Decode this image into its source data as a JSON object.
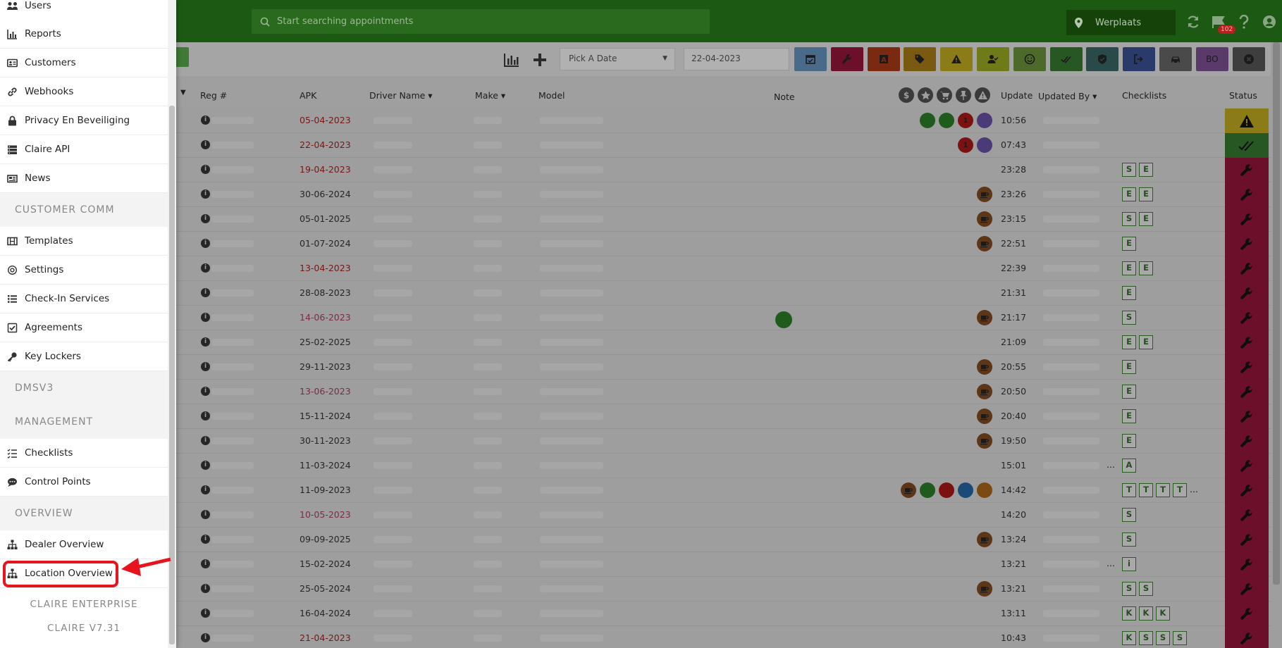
{
  "topbar": {
    "search_placeholder": "Start searching appointments",
    "location": "Werplaats",
    "notification_count": "102"
  },
  "toolbar": {
    "date_picker_label": "Pick A Date",
    "date_value": "22-04-2023",
    "filter_buttons": [
      {
        "icon": "calendar-check-icon",
        "color": "#4a6a8a"
      },
      {
        "icon": "wrench-icon",
        "color": "#6b0f2a"
      },
      {
        "icon": "a-letter-icon",
        "color": "#7a2a10"
      },
      {
        "icon": "tag-icon",
        "color": "#7a5a10"
      },
      {
        "icon": "warning-icon",
        "color": "#8b7c18"
      },
      {
        "icon": "user-check-icon",
        "color": "#6f7a18"
      },
      {
        "icon": "smile-icon",
        "color": "#4e6a2a"
      },
      {
        "icon": "double-check-icon",
        "color": "#275722"
      },
      {
        "icon": "shield-icon",
        "color": "#2a4a4a"
      },
      {
        "icon": "sign-out-icon",
        "color": "#2a3a6a"
      },
      {
        "icon": "car-icon",
        "color": "#4a4a4a"
      },
      {
        "label": "BO",
        "color": "#5a3a6a"
      },
      {
        "icon": "close-circle-icon",
        "color": "#3e3e3e"
      }
    ]
  },
  "table": {
    "columns": {
      "reg": "Reg #",
      "apk": "APK",
      "driver": "Driver Name",
      "make": "Make",
      "model": "Model",
      "note": "Note",
      "update": "Update",
      "updated_by": "Updated By",
      "checklists": "Checklists",
      "status": "Status"
    },
    "rows": [
      {
        "apk": "05-04-2023",
        "apk_state": "red",
        "update": "10:56",
        "icons": [
          "g",
          "g",
          "r1",
          "p"
        ],
        "chips": [],
        "status": "warn"
      },
      {
        "apk": "22-04-2023",
        "apk_state": "red",
        "update": "07:43",
        "icons": [
          "r1",
          "p"
        ],
        "chips": [],
        "status": "ok"
      },
      {
        "apk": "19-04-2023",
        "apk_state": "red",
        "update": "23:28",
        "icons": [],
        "chips": [
          "S",
          "E"
        ],
        "status": "wrench"
      },
      {
        "apk": "30-06-2024",
        "apk_state": "",
        "update": "23:26",
        "icons": [
          "coffee"
        ],
        "chips": [
          "E",
          "E"
        ],
        "status": "wrench"
      },
      {
        "apk": "05-01-2025",
        "apk_state": "",
        "update": "23:15",
        "icons": [
          "coffee"
        ],
        "chips": [
          "S",
          "E"
        ],
        "status": "wrench"
      },
      {
        "apk": "01-07-2024",
        "apk_state": "",
        "update": "22:51",
        "icons": [
          "coffee"
        ],
        "chips": [
          "E"
        ],
        "status": "wrench"
      },
      {
        "apk": "13-04-2023",
        "apk_state": "red",
        "update": "22:39",
        "icons": [],
        "chips": [
          "E",
          "E"
        ],
        "status": "wrench"
      },
      {
        "apk": "28-08-2023",
        "apk_state": "",
        "update": "21:31",
        "icons": [],
        "chips": [
          "E"
        ],
        "status": "wrench"
      },
      {
        "apk": "14-06-2023",
        "apk_state": "pink",
        "update": "21:17",
        "icons": [
          "coffee"
        ],
        "chips": [
          "S"
        ],
        "status": "wrench",
        "phone": true
      },
      {
        "apk": "25-02-2025",
        "apk_state": "",
        "update": "21:09",
        "icons": [],
        "chips": [
          "E",
          "E"
        ],
        "status": "wrench"
      },
      {
        "apk": "29-11-2023",
        "apk_state": "",
        "update": "20:55",
        "icons": [
          "coffee"
        ],
        "chips": [
          "E"
        ],
        "status": "wrench"
      },
      {
        "apk": "13-06-2023",
        "apk_state": "pink",
        "update": "20:50",
        "icons": [
          "coffee"
        ],
        "chips": [
          "E"
        ],
        "status": "wrench"
      },
      {
        "apk": "15-11-2024",
        "apk_state": "",
        "update": "20:40",
        "icons": [
          "coffee"
        ],
        "chips": [
          "E"
        ],
        "status": "wrench"
      },
      {
        "apk": "30-11-2023",
        "apk_state": "",
        "update": "19:50",
        "icons": [
          "coffee"
        ],
        "chips": [
          "E"
        ],
        "status": "wrench"
      },
      {
        "apk": "11-03-2024",
        "apk_state": "",
        "update": "15:01",
        "icons": [],
        "chips": [
          "A"
        ],
        "status": "wrench",
        "dots": true
      },
      {
        "apk": "11-09-2023",
        "apk_state": "",
        "update": "14:42",
        "icons": [
          "coffee",
          "g",
          "r",
          "b",
          "o"
        ],
        "chips": [
          "T",
          "T",
          "T",
          "T"
        ],
        "status": "wrench",
        "more": true
      },
      {
        "apk": "10-05-2023",
        "apk_state": "pink",
        "update": "14:20",
        "icons": [],
        "chips": [
          "S"
        ],
        "status": "wrench"
      },
      {
        "apk": "09-09-2025",
        "apk_state": "",
        "update": "13:24",
        "icons": [
          "coffee"
        ],
        "chips": [
          "S"
        ],
        "status": "wrench"
      },
      {
        "apk": "15-02-2024",
        "apk_state": "",
        "update": "13:21",
        "icons": [],
        "chips": [
          "i"
        ],
        "status": "wrench",
        "dots": true
      },
      {
        "apk": "25-05-2024",
        "apk_state": "",
        "update": "13:21",
        "icons": [
          "coffee"
        ],
        "chips": [
          "S",
          "S"
        ],
        "status": "wrench"
      },
      {
        "apk": "16-04-2024",
        "apk_state": "",
        "update": "13:11",
        "icons": [],
        "chips": [
          "K",
          "K",
          "K"
        ],
        "status": "wrench"
      },
      {
        "apk": "21-04-2023",
        "apk_state": "red",
        "update": "10:43",
        "icons": [],
        "chips": [
          "K",
          "S",
          "S",
          "S"
        ],
        "status": "wrench"
      }
    ]
  },
  "sidebar": {
    "items_top": [
      "Users",
      "Reports",
      "Customers",
      "Webhooks",
      "Privacy En Beveiliging",
      "Claire API",
      "News"
    ],
    "section_customer_comm": "CUSTOMER COMM",
    "items_comm": [
      "Templates",
      "Settings",
      "Check-In Services",
      "Agreements",
      "Key Lockers"
    ],
    "section_dmsv3": "DMSV3",
    "section_management": "MANAGEMENT",
    "items_management": [
      "Checklists",
      "Control Points"
    ],
    "section_overview": "OVERVIEW",
    "items_overview": [
      "Dealer Overview",
      "Location Overview"
    ],
    "footer_brand": "CLAIRE ENTERPRISE",
    "footer_version": "CLAIRE V7.31"
  },
  "highlight_color": "#e8141d"
}
